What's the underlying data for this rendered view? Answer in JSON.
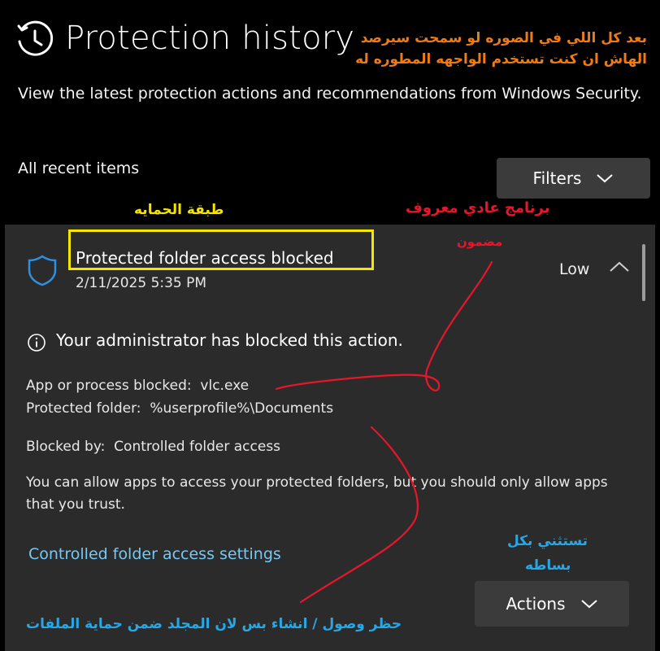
{
  "header": {
    "title": "Protection history",
    "title_icon": "history-clock-icon",
    "subtitle": "View the latest protection actions and recommendations from Windows Security.",
    "section_label": "All recent items",
    "filters_label": "Filters"
  },
  "item": {
    "icon": "shield-icon",
    "title": "Protected folder access blocked",
    "date": "2/11/2025 5:35 PM",
    "severity": "Low",
    "admin_message": "Your administrator has blocked this action.",
    "app_blocked": "App or process blocked:  vlc.exe",
    "protected_folder": "Protected folder:  %userprofile%\\Documents",
    "blocked_by": "Blocked by:  Controlled folder access",
    "help_text": "You can allow apps to access your protected folders, but you should only allow apps that you trust.",
    "settings_link": "Controlled folder access settings",
    "actions_label": "Actions"
  },
  "annotations": {
    "orange_line1": "بعد كل اللي في الصوره لو سمحت سيرصد",
    "orange_line2": "الهاش ان كنت تستخدم الواجهه المطوره له",
    "yellow_label": "طبقة الحمايه",
    "red_line1": "برنامج عادي معروف",
    "red_line2": "مضمون",
    "blue_line1": "تستثني بكل",
    "blue_line2": "بساطه",
    "blue_line3": "حظر وصول / انشاء بس لان المجلد ضمن حماية الملفات"
  },
  "colors": {
    "background": "#000000",
    "card": "#2b2b2b",
    "button": "#3b3b3b",
    "link": "#74c9f5",
    "shield": "#2f8fe0",
    "annotation_orange": "#f07a14",
    "annotation_yellow": "#f3e600",
    "annotation_red": "#e8162b",
    "annotation_blue": "#27a8e6"
  }
}
